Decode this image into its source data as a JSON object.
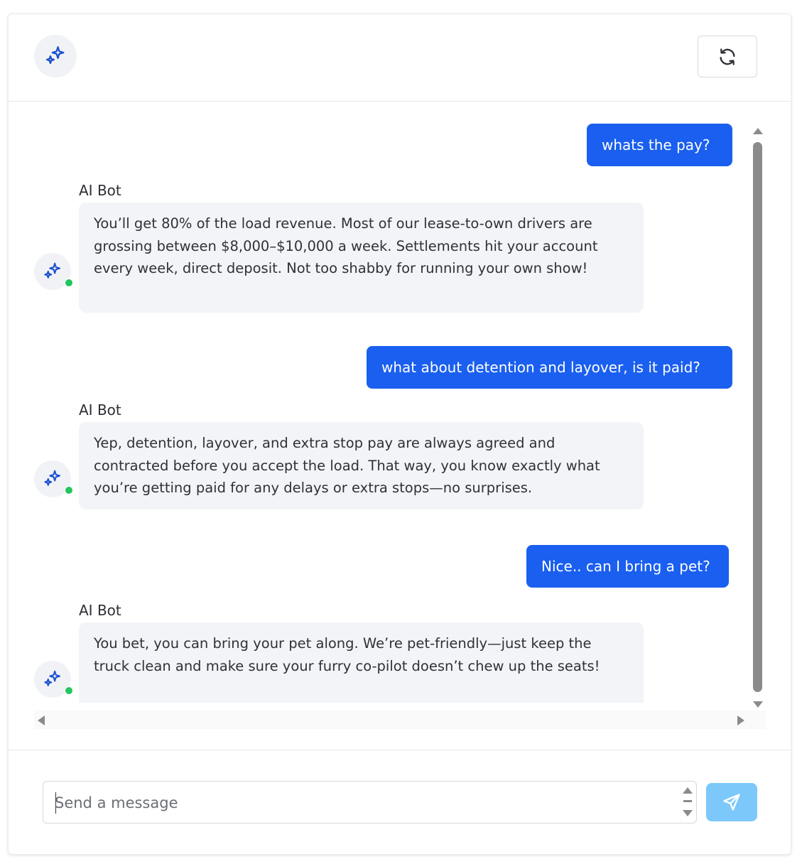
{
  "colors": {
    "accent": "#1a5fef",
    "bot_bubble": "#f2f4f8",
    "online": "#22c55e",
    "send_button": "#7cc8fa"
  },
  "header": {
    "avatar_icon": "sparkles-icon",
    "refresh_icon": "refresh-icon"
  },
  "messages": [
    {
      "role": "user",
      "text": "whats the pay?"
    },
    {
      "role": "bot",
      "sender": "AI Bot",
      "text": "You’ll get 80% of the load revenue. Most of our lease-to-own drivers are grossing between $8,000–$10,000 a week. Settlements hit your account every week, direct deposit. Not too shabby for running your own show!"
    },
    {
      "role": "user",
      "text": "what about detention and layover, is it paid?"
    },
    {
      "role": "bot",
      "sender": "AI Bot",
      "text": "Yep, detention, layover, and extra stop pay are always agreed and contracted before you accept the load. That way, you know exactly what you’re getting paid for any delays or extra stops—no surprises."
    },
    {
      "role": "user",
      "text": "Nice.. can I bring a pet?"
    },
    {
      "role": "bot",
      "sender": "AI Bot",
      "text": "You bet, you can bring your pet along. We’re pet-friendly—just keep the truck clean and make sure your furry co-pilot doesn’t chew up the seats!"
    }
  ],
  "composer": {
    "placeholder": "Send a message",
    "value": "",
    "send_icon": "send-icon"
  }
}
